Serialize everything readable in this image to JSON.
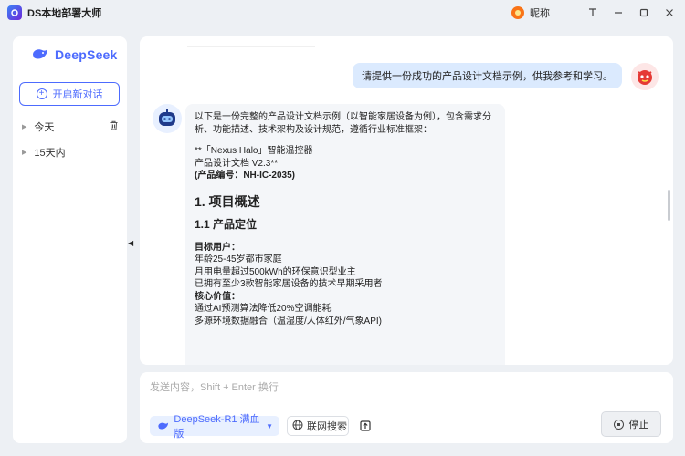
{
  "app": {
    "title": "DS本地部署大师"
  },
  "titlebar": {
    "nickname": "昵称",
    "pin_icon": "pin-icon"
  },
  "sidebar": {
    "logo_text": "DeepSeek",
    "new_chat_label": "开启新对话",
    "groups": [
      {
        "label": "今天"
      },
      {
        "label": "15天内"
      }
    ]
  },
  "chat": {
    "user_message": "请提供一份成功的产品设计文档示例，供我参考和学习。",
    "bot": {
      "intro": "以下是一份完整的产品设计文档示例（以智能家居设备为例），包含需求分析、功能描述、技术架构及设计规范，遵循行业标准框架：",
      "product_line": "**「Nexus Halo」智能温控器",
      "doc_line": "产品设计文档 V2.3**",
      "code_line": "(产品编号：NH-IC-2035)",
      "h1": "1. 项目概述",
      "h2": "1.1 产品定位",
      "target_users_label": "目标用户：",
      "target_users": [
        "年龄25-45岁都市家庭",
        "月用电量超过500kWh的环保意识型业主",
        "已拥有至少3款智能家居设备的技术早期采用者"
      ],
      "core_value_label": "核心价值：",
      "core_values": [
        "通过AI预测算法降低20%空调能耗",
        "多源环境数据融合（温湿度/人体红外/气象API)"
      ]
    }
  },
  "input": {
    "placeholder": "发送内容，Shift + Enter 换行",
    "model_label": "DeepSeek-R1 满血版",
    "web_search_label": "联网搜索",
    "stop_label": "停止"
  },
  "colors": {
    "accent": "#4d6bfe",
    "user_bubble": "#dbeafe",
    "bot_bubble": "#f4f6f9"
  }
}
